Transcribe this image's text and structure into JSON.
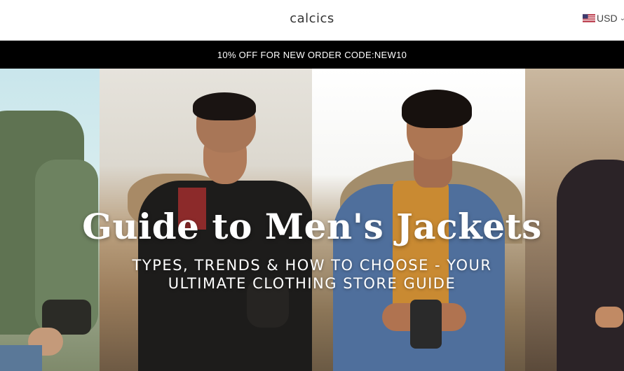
{
  "header": {
    "logo": "calcics",
    "currency": {
      "label": "USD",
      "flag_icon": "us-flag-icon"
    }
  },
  "announcement": {
    "text": "10% OFF FOR NEW ORDER CODE:NEW10"
  },
  "hero": {
    "title": "Guide to Men's Jackets",
    "subtitle_line1": "TYPES, TRENDS & HOW TO CHOOSE - YOUR",
    "subtitle_line2": "ULTIMATE CLOTHING STORE GUIDE"
  }
}
